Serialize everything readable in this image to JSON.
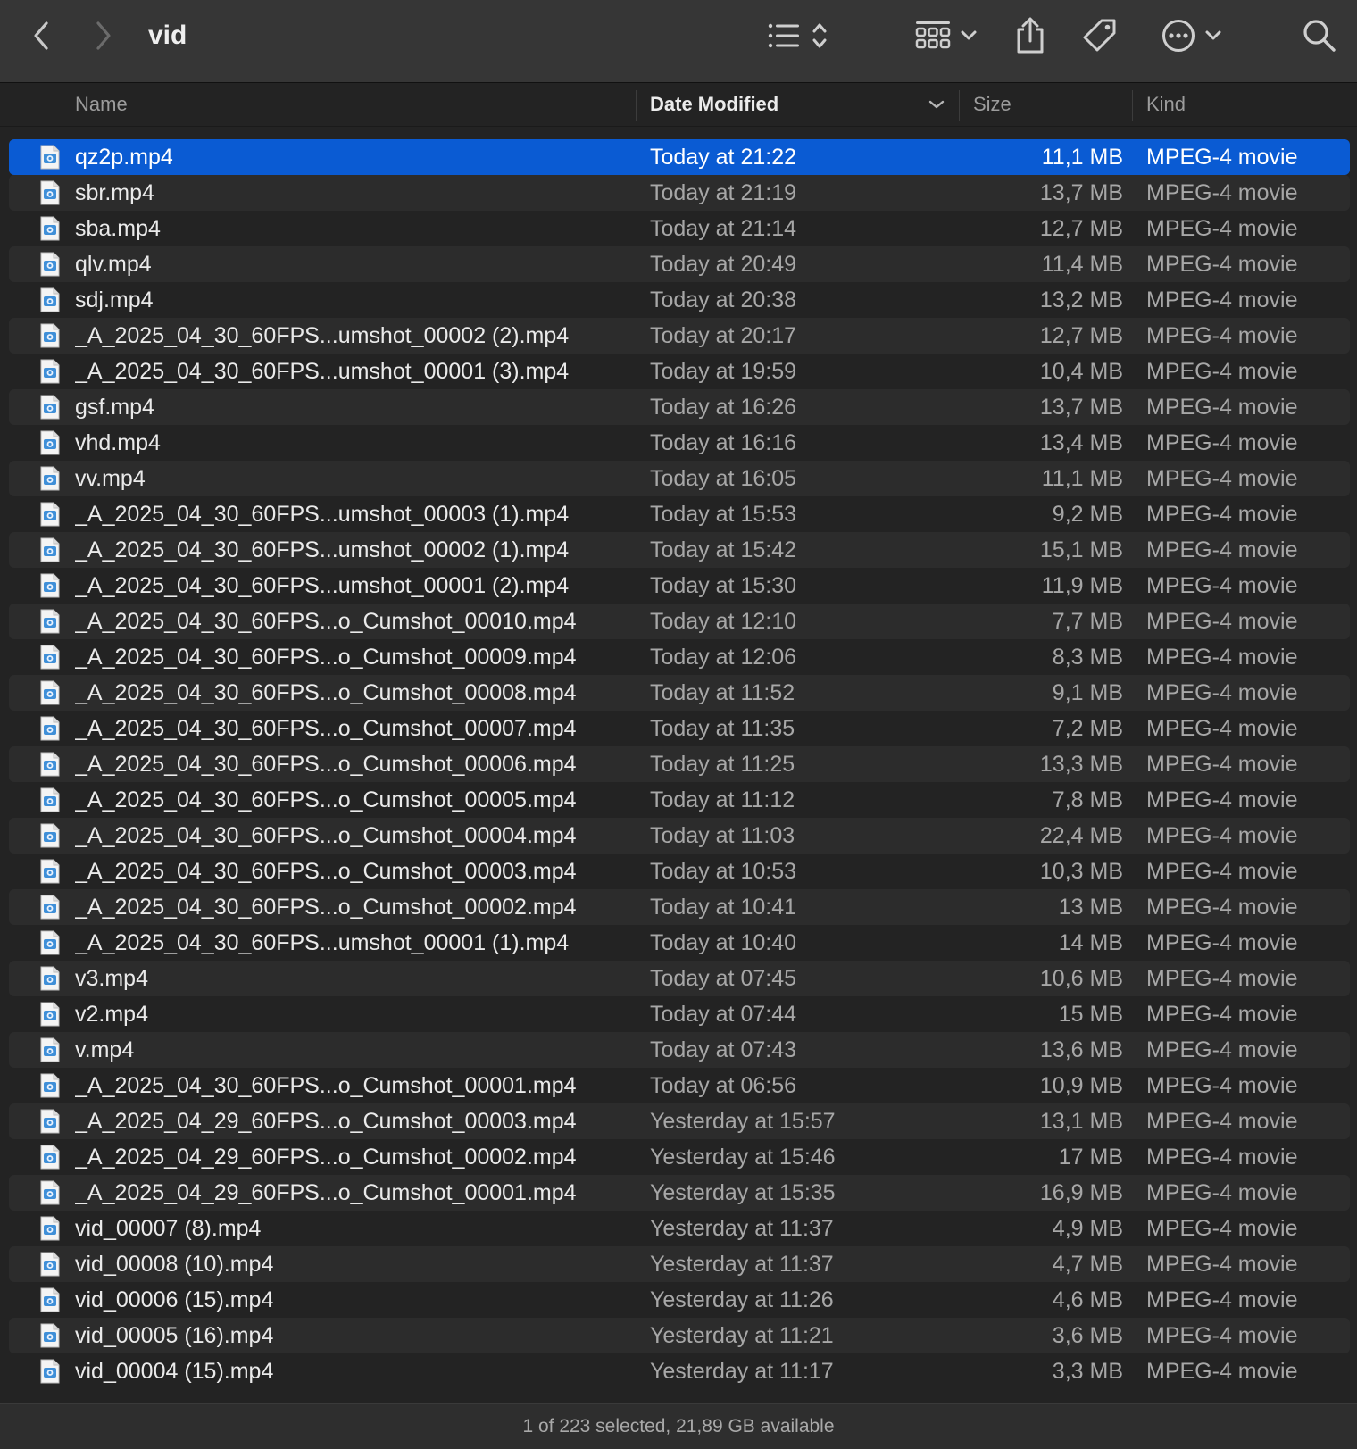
{
  "window": {
    "title": "vid",
    "toolbar": {
      "back_icon": "chevron-left-icon",
      "forward_icon": "chevron-right-icon",
      "list_view_icon": "list-view-icon",
      "group_view_icon": "icon-grid-view-icon",
      "share_icon": "share-icon",
      "tag_icon": "tag-icon",
      "more_icon": "ellipsis-circle-icon",
      "search_icon": "search-icon"
    }
  },
  "columns": {
    "name": "Name",
    "date": "Date Modified",
    "size": "Size",
    "kind": "Kind",
    "sorted_by": "date",
    "sort_direction": "descending"
  },
  "colors": {
    "selection": "#0a5bd3",
    "background": "#232323",
    "alt_row": "#2c2c2c",
    "toolbar": "#363636"
  },
  "files": [
    {
      "name": "qz2p.mp4",
      "date": "Today at 21:22",
      "size": "11,1 MB",
      "kind": "MPEG-4 movie",
      "selected": true
    },
    {
      "name": "sbr.mp4",
      "date": "Today at 21:19",
      "size": "13,7 MB",
      "kind": "MPEG-4 movie"
    },
    {
      "name": "sba.mp4",
      "date": "Today at 21:14",
      "size": "12,7 MB",
      "kind": "MPEG-4 movie"
    },
    {
      "name": "qlv.mp4",
      "date": "Today at 20:49",
      "size": "11,4 MB",
      "kind": "MPEG-4 movie"
    },
    {
      "name": "sdj.mp4",
      "date": "Today at 20:38",
      "size": "13,2 MB",
      "kind": "MPEG-4 movie"
    },
    {
      "name": "_A_2025_04_30_60FPS...umshot_00002 (2).mp4",
      "date": "Today at 20:17",
      "size": "12,7 MB",
      "kind": "MPEG-4 movie"
    },
    {
      "name": "_A_2025_04_30_60FPS...umshot_00001 (3).mp4",
      "date": "Today at 19:59",
      "size": "10,4 MB",
      "kind": "MPEG-4 movie"
    },
    {
      "name": "gsf.mp4",
      "date": "Today at 16:26",
      "size": "13,7 MB",
      "kind": "MPEG-4 movie"
    },
    {
      "name": "vhd.mp4",
      "date": "Today at 16:16",
      "size": "13,4 MB",
      "kind": "MPEG-4 movie"
    },
    {
      "name": "vv.mp4",
      "date": "Today at 16:05",
      "size": "11,1 MB",
      "kind": "MPEG-4 movie"
    },
    {
      "name": "_A_2025_04_30_60FPS...umshot_00003 (1).mp4",
      "date": "Today at 15:53",
      "size": "9,2 MB",
      "kind": "MPEG-4 movie"
    },
    {
      "name": "_A_2025_04_30_60FPS...umshot_00002 (1).mp4",
      "date": "Today at 15:42",
      "size": "15,1 MB",
      "kind": "MPEG-4 movie"
    },
    {
      "name": "_A_2025_04_30_60FPS...umshot_00001 (2).mp4",
      "date": "Today at 15:30",
      "size": "11,9 MB",
      "kind": "MPEG-4 movie"
    },
    {
      "name": "_A_2025_04_30_60FPS...o_Cumshot_00010.mp4",
      "date": "Today at 12:10",
      "size": "7,7 MB",
      "kind": "MPEG-4 movie"
    },
    {
      "name": "_A_2025_04_30_60FPS...o_Cumshot_00009.mp4",
      "date": "Today at 12:06",
      "size": "8,3 MB",
      "kind": "MPEG-4 movie"
    },
    {
      "name": "_A_2025_04_30_60FPS...o_Cumshot_00008.mp4",
      "date": "Today at 11:52",
      "size": "9,1 MB",
      "kind": "MPEG-4 movie"
    },
    {
      "name": "_A_2025_04_30_60FPS...o_Cumshot_00007.mp4",
      "date": "Today at 11:35",
      "size": "7,2 MB",
      "kind": "MPEG-4 movie"
    },
    {
      "name": "_A_2025_04_30_60FPS...o_Cumshot_00006.mp4",
      "date": "Today at 11:25",
      "size": "13,3 MB",
      "kind": "MPEG-4 movie"
    },
    {
      "name": "_A_2025_04_30_60FPS...o_Cumshot_00005.mp4",
      "date": "Today at 11:12",
      "size": "7,8 MB",
      "kind": "MPEG-4 movie"
    },
    {
      "name": "_A_2025_04_30_60FPS...o_Cumshot_00004.mp4",
      "date": "Today at 11:03",
      "size": "22,4 MB",
      "kind": "MPEG-4 movie"
    },
    {
      "name": "_A_2025_04_30_60FPS...o_Cumshot_00003.mp4",
      "date": "Today at 10:53",
      "size": "10,3 MB",
      "kind": "MPEG-4 movie"
    },
    {
      "name": "_A_2025_04_30_60FPS...o_Cumshot_00002.mp4",
      "date": "Today at 10:41",
      "size": "13 MB",
      "kind": "MPEG-4 movie"
    },
    {
      "name": "_A_2025_04_30_60FPS...umshot_00001 (1).mp4",
      "date": "Today at 10:40",
      "size": "14 MB",
      "kind": "MPEG-4 movie"
    },
    {
      "name": "v3.mp4",
      "date": "Today at 07:45",
      "size": "10,6 MB",
      "kind": "MPEG-4 movie"
    },
    {
      "name": "v2.mp4",
      "date": "Today at 07:44",
      "size": "15 MB",
      "kind": "MPEG-4 movie"
    },
    {
      "name": "v.mp4",
      "date": "Today at 07:43",
      "size": "13,6 MB",
      "kind": "MPEG-4 movie"
    },
    {
      "name": "_A_2025_04_30_60FPS...o_Cumshot_00001.mp4",
      "date": "Today at 06:56",
      "size": "10,9 MB",
      "kind": "MPEG-4 movie"
    },
    {
      "name": "_A_2025_04_29_60FPS...o_Cumshot_00003.mp4",
      "date": "Yesterday at 15:57",
      "size": "13,1 MB",
      "kind": "MPEG-4 movie"
    },
    {
      "name": "_A_2025_04_29_60FPS...o_Cumshot_00002.mp4",
      "date": "Yesterday at 15:46",
      "size": "17 MB",
      "kind": "MPEG-4 movie"
    },
    {
      "name": "_A_2025_04_29_60FPS...o_Cumshot_00001.mp4",
      "date": "Yesterday at 15:35",
      "size": "16,9 MB",
      "kind": "MPEG-4 movie"
    },
    {
      "name": "vid_00007 (8).mp4",
      "date": "Yesterday at 11:37",
      "size": "4,9 MB",
      "kind": "MPEG-4 movie"
    },
    {
      "name": "vid_00008 (10).mp4",
      "date": "Yesterday at 11:37",
      "size": "4,7 MB",
      "kind": "MPEG-4 movie"
    },
    {
      "name": "vid_00006 (15).mp4",
      "date": "Yesterday at 11:26",
      "size": "4,6 MB",
      "kind": "MPEG-4 movie"
    },
    {
      "name": "vid_00005 (16).mp4",
      "date": "Yesterday at 11:21",
      "size": "3,6 MB",
      "kind": "MPEG-4 movie"
    },
    {
      "name": "vid_00004 (15).mp4",
      "date": "Yesterday at 11:17",
      "size": "3,3 MB",
      "kind": "MPEG-4 movie"
    }
  ],
  "status": "1 of 223 selected, 21,89 GB available"
}
